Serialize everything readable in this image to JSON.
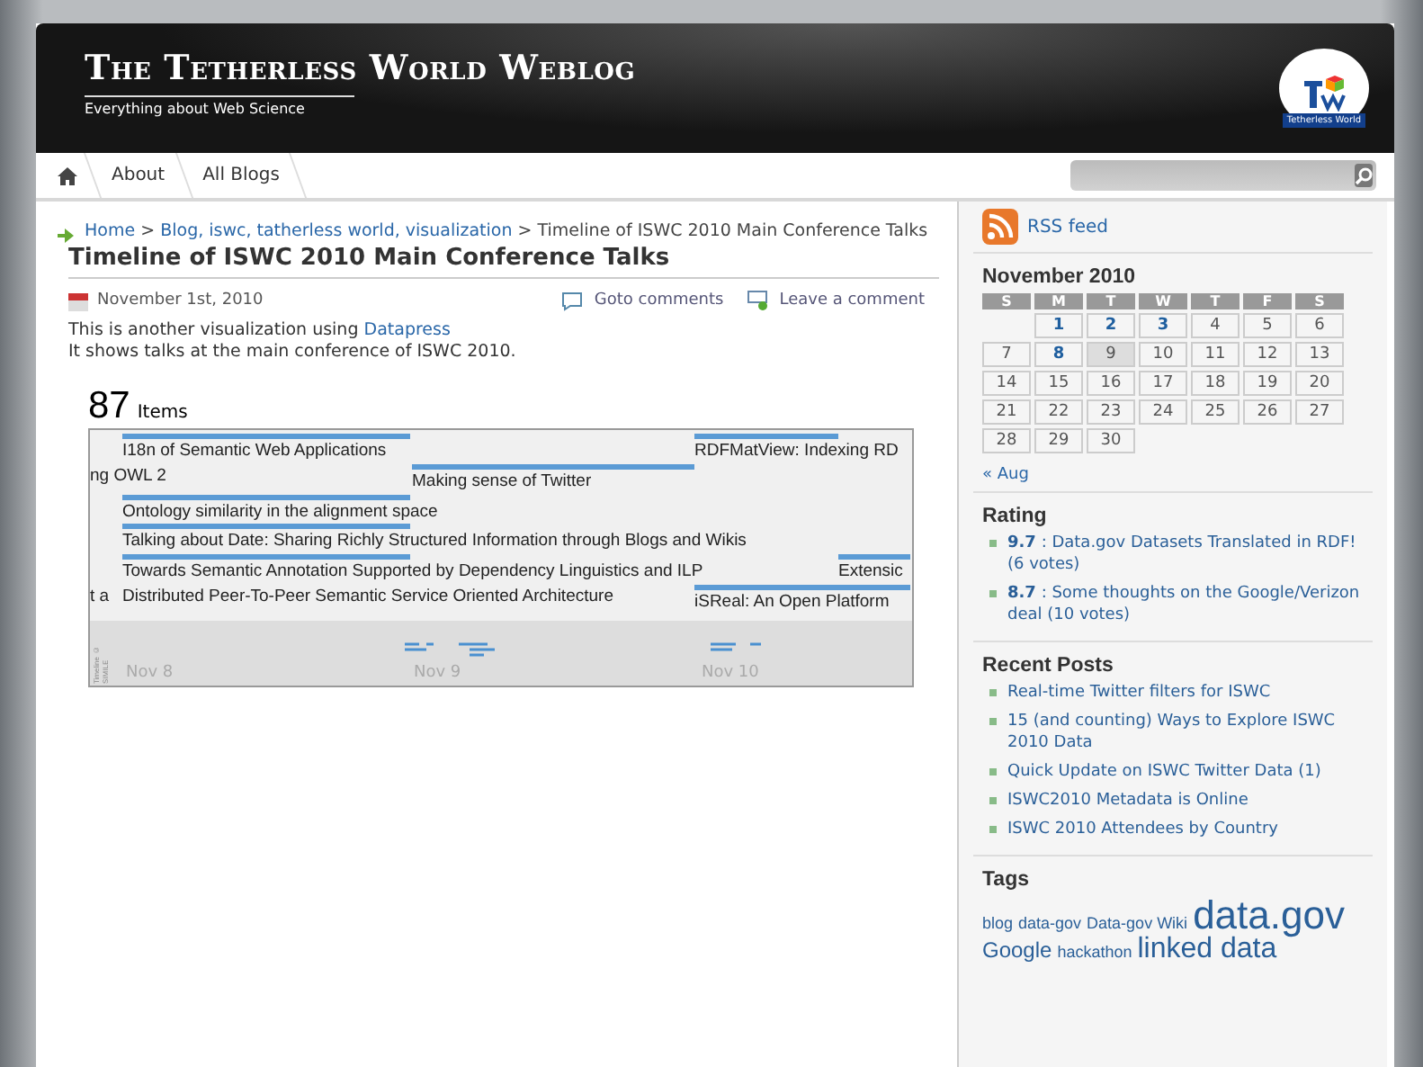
{
  "header": {
    "title": "The Tetherless World Weblog",
    "tagline": "Everything about Web Science",
    "logo_text": "Tetherless World"
  },
  "nav": {
    "items": [
      {
        "label": "About"
      },
      {
        "label": "All Blogs"
      }
    ]
  },
  "breadcrumb": [
    {
      "label": "Home",
      "link": true
    },
    {
      "label": ">",
      "link": false
    },
    {
      "label": "Blog, iswc, tatherless world, visualization",
      "link": true
    },
    {
      "label": ">",
      "link": false
    },
    {
      "label": "Timeline of ISWC 2010 Main Conference Talks",
      "link": false
    }
  ],
  "post": {
    "title": "Timeline of ISWC 2010 Main Conference Talks",
    "date": "November 1st, 2010",
    "goto_comments": "Goto comments",
    "leave_comment": "Leave a comment",
    "intro": "This is another visualization using",
    "intro_link": "Datapress",
    "line2": "It shows talks at the main conference of ISWC 2010.",
    "count": "87",
    "count_label": "Items"
  },
  "timeline": {
    "credit": "Timeline © SIMILE",
    "lanes": [
      [
        {
          "label": "I18n of Semantic Web Applications"
        },
        {
          "label": "RDFMatView: Indexing RD"
        }
      ],
      [
        {
          "label": "ng OWL 2"
        },
        {
          "label": "Making sense of Twitter"
        }
      ],
      [
        {
          "label": "Ontology similarity in the alignment space"
        }
      ],
      [
        {
          "label": "Talking about Date: Sharing Richly Structured Information through Blogs and Wikis"
        }
      ],
      [
        {
          "label": "Towards Semantic Annotation Supported by Dependency Linguistics and ILP"
        },
        {
          "label": "Extensic"
        }
      ],
      [
        {
          "label": "t a"
        },
        {
          "label": "Distributed Peer-To-Peer Semantic Service Oriented Architecture"
        },
        {
          "label": "iSReal: An Open Platform"
        }
      ]
    ],
    "dates": [
      "Nov 8",
      "Nov 9",
      "Nov 10"
    ]
  },
  "sidebar": {
    "rss": "RSS feed",
    "calendar": {
      "title": "November 2010",
      "weekdays": [
        "S",
        "M",
        "T",
        "W",
        "T",
        "F",
        "S"
      ],
      "days": [
        {
          "day": "1",
          "linked": true,
          "today": false
        },
        {
          "day": "2",
          "linked": true,
          "today": false
        },
        {
          "day": "3",
          "linked": true,
          "today": false
        },
        {
          "day": "4",
          "linked": false,
          "today": false
        },
        {
          "day": "5",
          "linked": false,
          "today": false
        },
        {
          "day": "6",
          "linked": false,
          "today": false
        },
        {
          "day": "7",
          "linked": false,
          "today": false
        },
        {
          "day": "8",
          "linked": true,
          "today": false
        },
        {
          "day": "9",
          "linked": false,
          "today": true
        },
        {
          "day": "10",
          "linked": false,
          "today": false
        },
        {
          "day": "11",
          "linked": false,
          "today": false
        },
        {
          "day": "12",
          "linked": false,
          "today": false
        },
        {
          "day": "13",
          "linked": false,
          "today": false
        },
        {
          "day": "14",
          "linked": false,
          "today": false
        },
        {
          "day": "15",
          "linked": false,
          "today": false
        },
        {
          "day": "16",
          "linked": false,
          "today": false
        },
        {
          "day": "17",
          "linked": false,
          "today": false
        },
        {
          "day": "18",
          "linked": false,
          "today": false
        },
        {
          "day": "19",
          "linked": false,
          "today": false
        },
        {
          "day": "20",
          "linked": false,
          "today": false
        },
        {
          "day": "21",
          "linked": false,
          "today": false
        },
        {
          "day": "22",
          "linked": false,
          "today": false
        },
        {
          "day": "23",
          "linked": false,
          "today": false
        },
        {
          "day": "24",
          "linked": false,
          "today": false
        },
        {
          "day": "25",
          "linked": false,
          "today": false
        },
        {
          "day": "26",
          "linked": false,
          "today": false
        },
        {
          "day": "27",
          "linked": false,
          "today": false
        },
        {
          "day": "28",
          "linked": false,
          "today": false
        },
        {
          "day": "29",
          "linked": false,
          "today": false
        },
        {
          "day": "30",
          "linked": false,
          "today": false
        }
      ],
      "prev": "« Aug"
    },
    "rating": {
      "title": "Rating",
      "items": [
        "**9.7** : Data.gov Datasets Translated in RDF! (6 votes)",
        "**8.7** : Some thoughts on the Google/Verizon deal (10 votes)"
      ]
    },
    "recent": {
      "title": "Recent Posts",
      "items": [
        "Real-time Twitter filters for ISWC",
        "15 (and counting) Ways to Explore ISWC 2010 Data",
        "Quick Update on ISWC Twitter Data (1)",
        "ISWC2010 Metadata is Online",
        "ISWC 2010 Attendees by Country"
      ]
    },
    "tags": {
      "title": "Tags",
      "items": [
        {
          "label": "blog",
          "kind": "small"
        },
        {
          "label": "data-gov",
          "kind": "small"
        },
        {
          "label": "Data-gov Wiki",
          "kind": "small"
        },
        {
          "label": "data.gov",
          "kind": "huge"
        },
        {
          "label": "Google",
          "kind": "medium"
        },
        {
          "label": "hackathon",
          "kind": "small"
        },
        {
          "label": "linked data",
          "kind": "large"
        }
      ]
    }
  }
}
